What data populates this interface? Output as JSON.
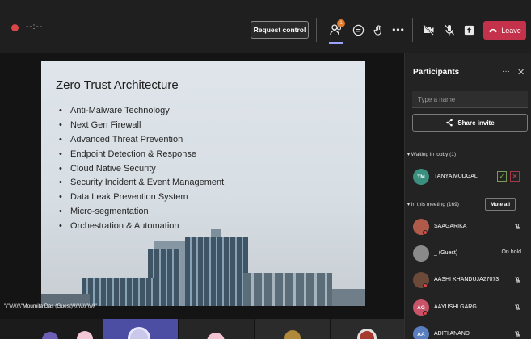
{
  "call": {
    "timer": "--:--",
    "request_control_label": "Request control",
    "participants_badge": "1",
    "leave_label": "Leave"
  },
  "slide": {
    "title": "Zero Trust Architecture",
    "bullets": [
      "Anti-Malware Technology",
      "Next Gen Firewall",
      "Advanced Threat Prevention",
      "Endpoint Detection & Response",
      "Cloud Native Security",
      "Security Incident & Event Management",
      "Data Leak Prevention System",
      "Micro-segmentation",
      "Orchestration & Automation"
    ]
  },
  "speaker_label": "\"\\\"\\\\\\\\\\\\\\\\\"Moumita Das (Guest)\\\\\\\\\\\\\\\\\\\"\\\\\\\\\\\"",
  "panel": {
    "title": "Participants",
    "search_placeholder": "Type a name",
    "share_label": "Share invite",
    "lobby_header": "Waiting in lobby (1)",
    "meeting_header": "In this meeting (169)",
    "mute_all_label": "Mute all",
    "lobby": [
      {
        "initials": "TM",
        "name": "TANYA MUDGAL",
        "color": "#3a8f7f"
      }
    ],
    "meeting": [
      {
        "initials": "",
        "name": "SAAGARIKA",
        "status": "",
        "color": "#b05a4a"
      },
      {
        "initials": "",
        "name": "_ (Guest)",
        "status": "On hold",
        "color": "#8a8a8a"
      },
      {
        "initials": "",
        "name": "AASHI KHANDUJA27073",
        "status": "",
        "color": "#6b4a3a"
      },
      {
        "initials": "AG",
        "name": "AAYUSHI GARG",
        "status": "",
        "color": "#c9546a"
      },
      {
        "initials": "AA",
        "name": "ADITI ANAND",
        "status": "",
        "color": "#5a7fc0"
      }
    ]
  },
  "colors": {
    "leave": "#c4314b",
    "accent": "#9ea2ff",
    "badge": "#e3792b"
  }
}
